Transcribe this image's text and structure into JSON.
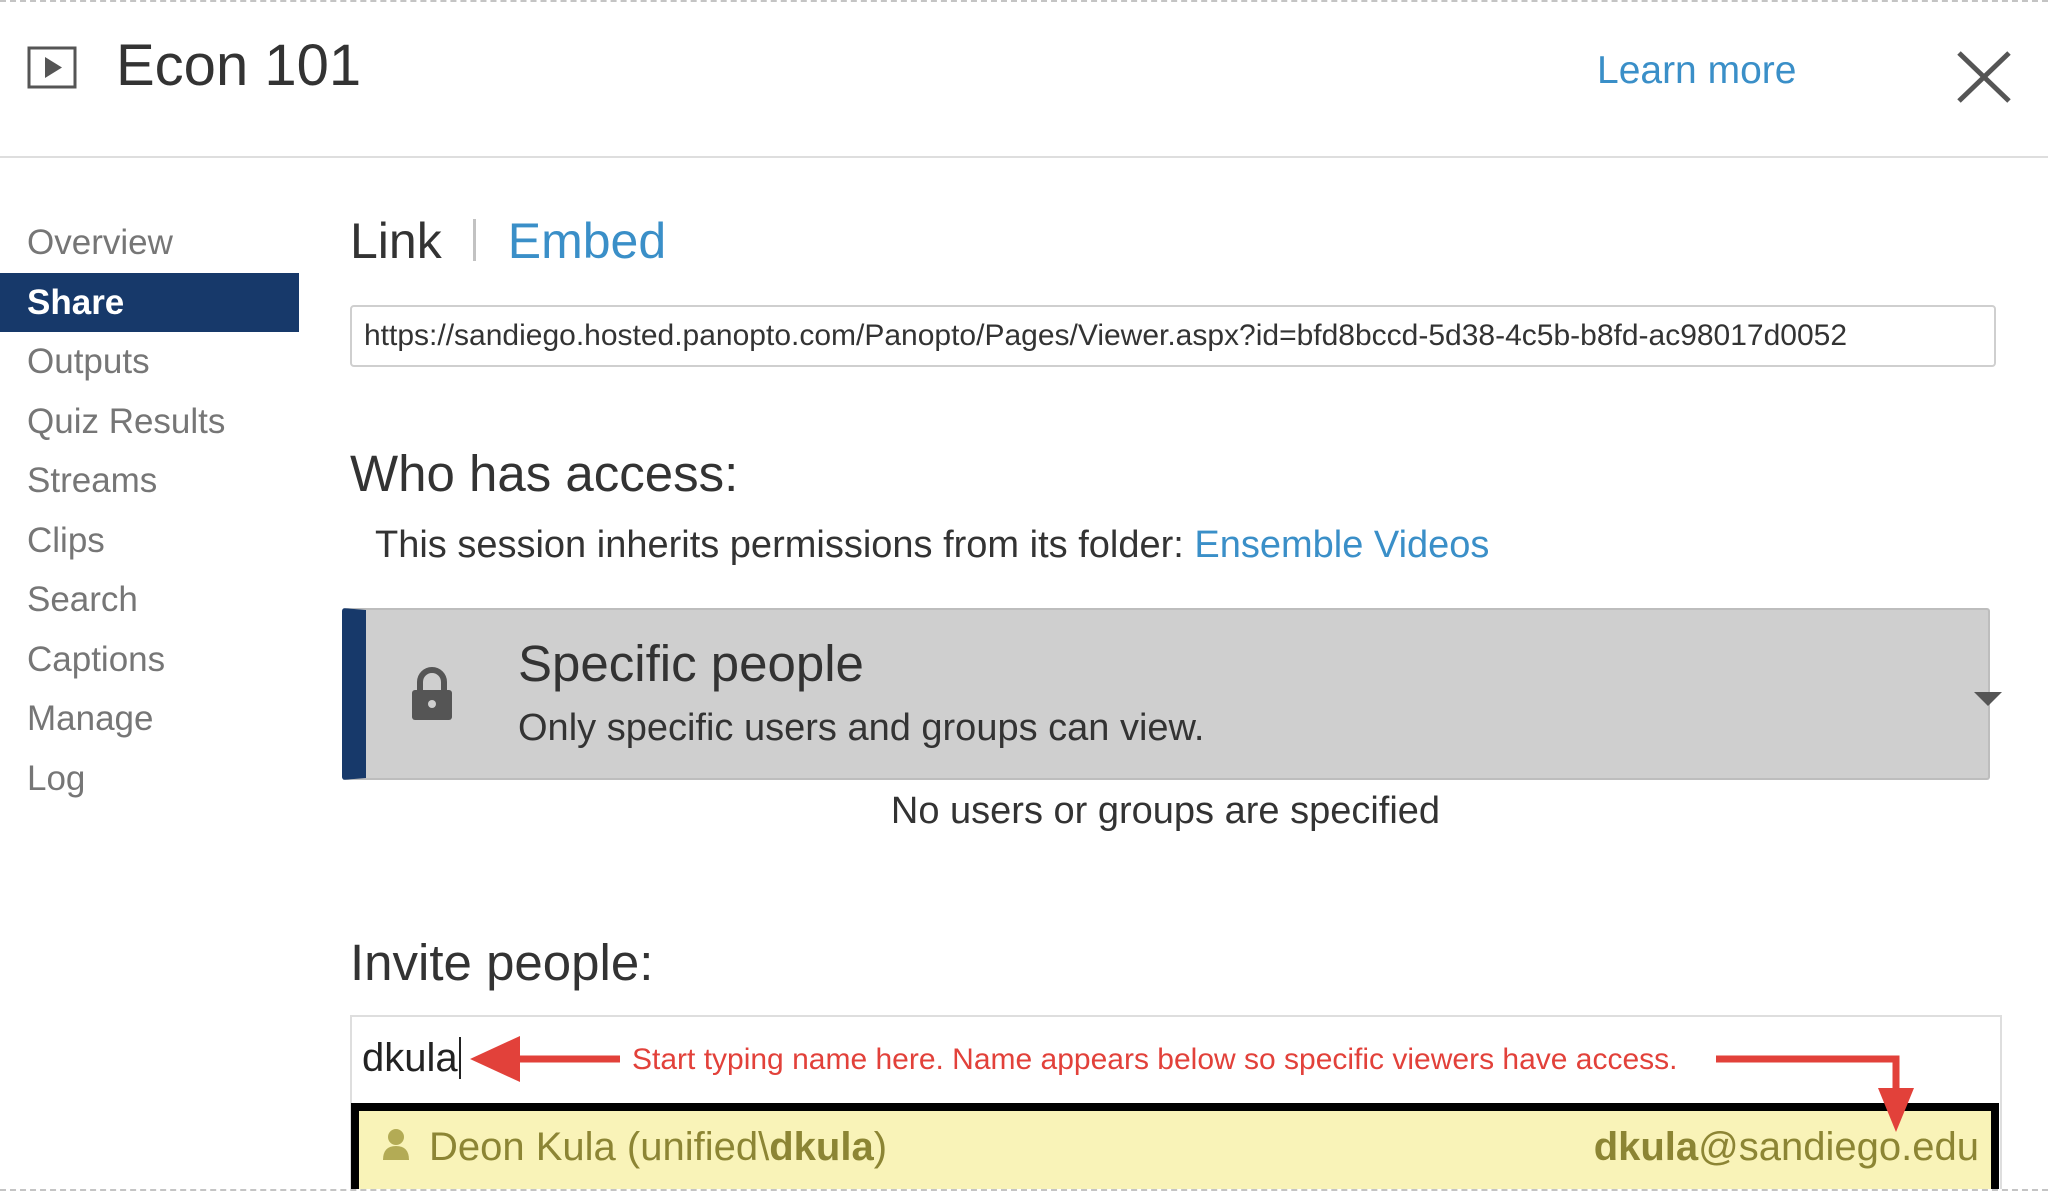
{
  "header": {
    "title": "Econ 101",
    "learn_more": "Learn more"
  },
  "sidebar": {
    "items": [
      {
        "label": "Overview"
      },
      {
        "label": "Share",
        "active": true
      },
      {
        "label": "Outputs"
      },
      {
        "label": "Quiz Results"
      },
      {
        "label": "Streams"
      },
      {
        "label": "Clips"
      },
      {
        "label": "Search"
      },
      {
        "label": "Captions"
      },
      {
        "label": "Manage"
      },
      {
        "label": "Log"
      }
    ]
  },
  "share": {
    "tabs": {
      "link": "Link",
      "embed": "Embed"
    },
    "url": "https://sandiego.hosted.panopto.com/Panopto/Pages/Viewer.aspx?id=bfd8bccd-5d38-4c5b-b8fd-ac98017d0052",
    "access": {
      "heading": "Who has access:",
      "inherit_text": "This session inherits permissions from its folder: ",
      "folder_link": "Ensemble Videos",
      "selected_title": "Specific people",
      "selected_desc": "Only specific users and groups can view.",
      "no_users": "No users or groups are specified"
    },
    "invite": {
      "heading": "Invite people:",
      "input_value": "dkula",
      "annotation": "Start typing name here. Name appears below so specific viewers have access.",
      "suggestion": {
        "name_prefix": "Deon Kula (unified\\",
        "name_bold": "dkula",
        "name_suffix": ")",
        "email_bold": "dkula",
        "email_rest": "@sandiego.edu"
      }
    }
  },
  "colors": {
    "accent_link": "#3a8fc8",
    "nav_active": "#17396a",
    "annotation": "#e2413a",
    "suggestion_bg": "#f9f3b8"
  },
  "icons": [
    "video-icon",
    "close-icon",
    "lock-icon",
    "chevron-down-icon",
    "person-icon"
  ]
}
